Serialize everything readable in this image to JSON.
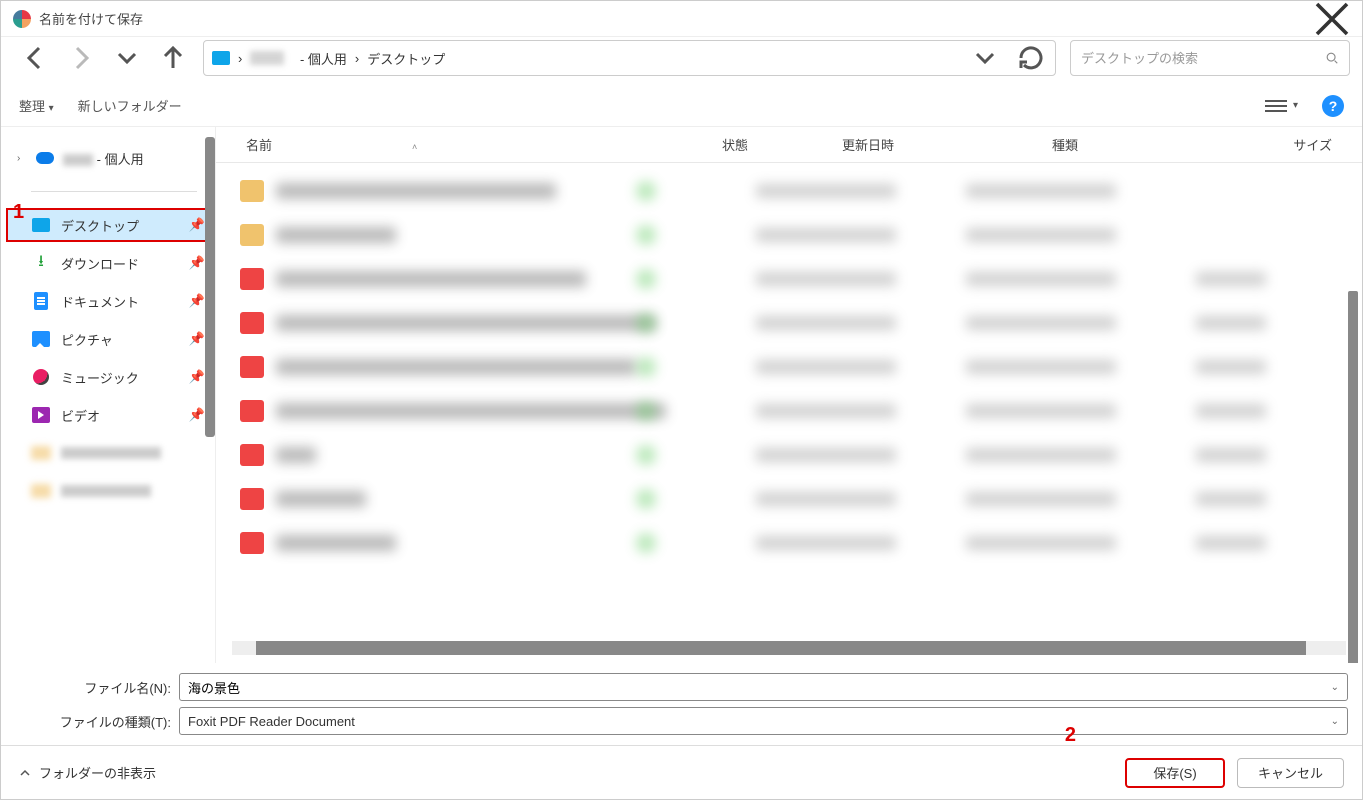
{
  "title": "名前を付けて保存",
  "breadcrumb": {
    "mid_personal": "- 個人用",
    "leaf": "デスクトップ"
  },
  "search_placeholder": "デスクトップの検索",
  "toolbar": {
    "organize": "整理",
    "new_folder": "新しいフォルダー"
  },
  "sidebar": {
    "root": "- 個人用",
    "items": [
      {
        "label": "デスクトップ"
      },
      {
        "label": "ダウンロード"
      },
      {
        "label": "ドキュメント"
      },
      {
        "label": "ピクチャ"
      },
      {
        "label": "ミュージック"
      },
      {
        "label": "ビデオ"
      }
    ]
  },
  "columns": {
    "name": "名前",
    "state": "状態",
    "date": "更新日時",
    "type": "種類",
    "size": "サイズ"
  },
  "form": {
    "filename_label": "ファイル名(N):",
    "filename_value": "海の景色",
    "filetype_label": "ファイルの種類(T):",
    "filetype_value": "Foxit PDF Reader Document"
  },
  "footer": {
    "hide_folders": "フォルダーの非表示",
    "save": "保存(S)",
    "cancel": "キャンセル"
  },
  "annotations": {
    "1": "1",
    "2": "2"
  }
}
